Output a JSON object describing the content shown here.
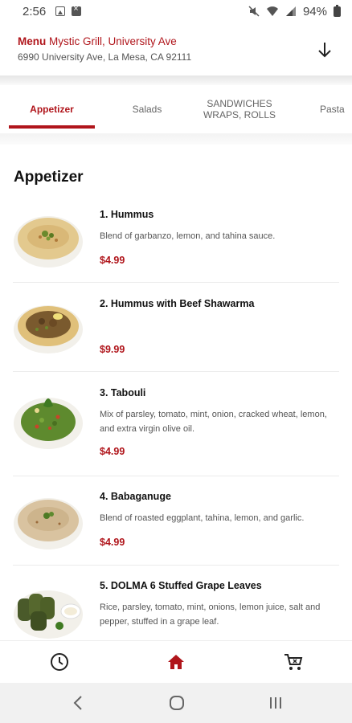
{
  "status_bar": {
    "time": "2:56",
    "battery": "94%",
    "icons": [
      "image-icon",
      "notification-icon",
      "mute-icon",
      "wifi-icon",
      "signal-icon",
      "battery-icon"
    ]
  },
  "header": {
    "menu_label": "Menu",
    "restaurant": "Mystic Grill, University Ave",
    "address": "6990 University Ave, La Mesa, CA 92111",
    "accent_color": "#b0151b"
  },
  "tabs": [
    {
      "label": "Appetizer",
      "active": true
    },
    {
      "label": "Salads",
      "active": false
    },
    {
      "label": "SANDWICHES\nWRAPS, ROLLS",
      "active": false
    },
    {
      "label": "Pasta",
      "active": false
    }
  ],
  "section": {
    "title": "Appetizer"
  },
  "items": [
    {
      "name": "1. Hummus",
      "description": "Blend of garbanzo, lemon, and tahina sauce.",
      "price": "$4.99"
    },
    {
      "name": "2. Hummus with Beef Shawarma",
      "description": "",
      "price": "$9.99"
    },
    {
      "name": "3. Tabouli",
      "description": "Mix of parsley, tomato, mint, onion, cracked wheat, lemon, and extra virgin olive oil.",
      "price": "$4.99"
    },
    {
      "name": "4. Babaganuge",
      "description": "Blend of roasted eggplant, tahina, lemon, and garlic.",
      "price": "$4.99"
    },
    {
      "name": "5. DOLMA 6 Stuffed Grape Leaves",
      "description": "Rice, parsley, tomato, mint, onions, lemon juice, salt and pepper, stuffed in a grape leaf.",
      "price": ""
    }
  ],
  "bottom_nav": [
    {
      "icon": "clock-icon",
      "active": false
    },
    {
      "icon": "home-icon",
      "active": true
    },
    {
      "icon": "cart-icon",
      "active": false
    }
  ],
  "system_nav": [
    "back-icon",
    "home-circle-icon",
    "recents-icon"
  ]
}
